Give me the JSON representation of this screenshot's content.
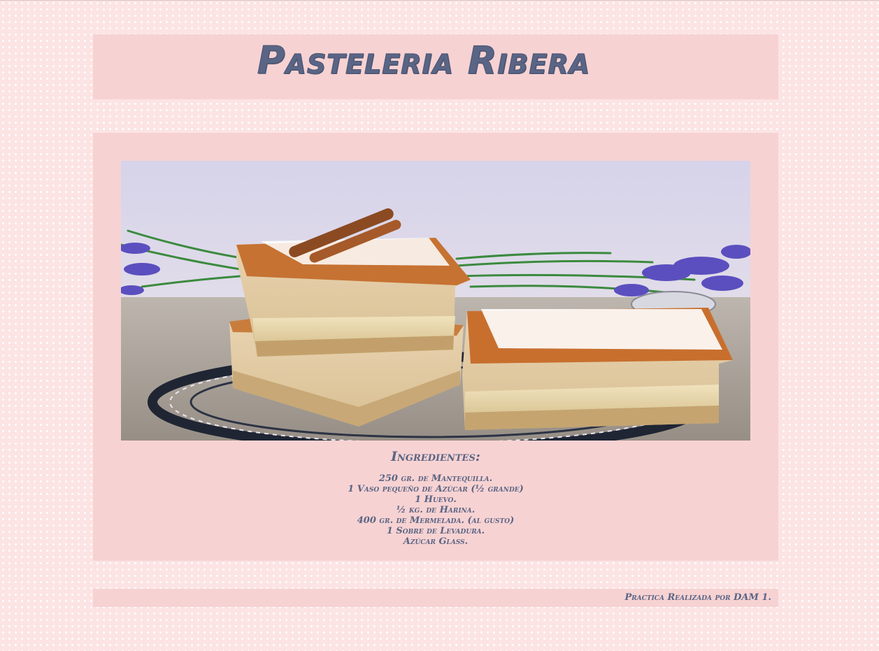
{
  "header": {
    "title": "Pasteleria Ribera"
  },
  "main": {
    "photo_icon": "cake-photo",
    "ingredients_title": "Ingredientes:",
    "ingredients": [
      "250 gr. de Mantequilla.",
      "1 Vaso pequeño de Azúcar (½ grande)",
      "1 Huevo.",
      "½ kg. de Harina.",
      "400 gr. de Mermelada. (al gusto)",
      "1 Sobre de Levadura.",
      "Azúcar Glass."
    ]
  },
  "footer": {
    "credit": "Practica Realizada por DAM 1."
  },
  "colors": {
    "page_background": "#fce4e4",
    "panel_background": "#f7d2d2",
    "text": "#5a6585"
  }
}
